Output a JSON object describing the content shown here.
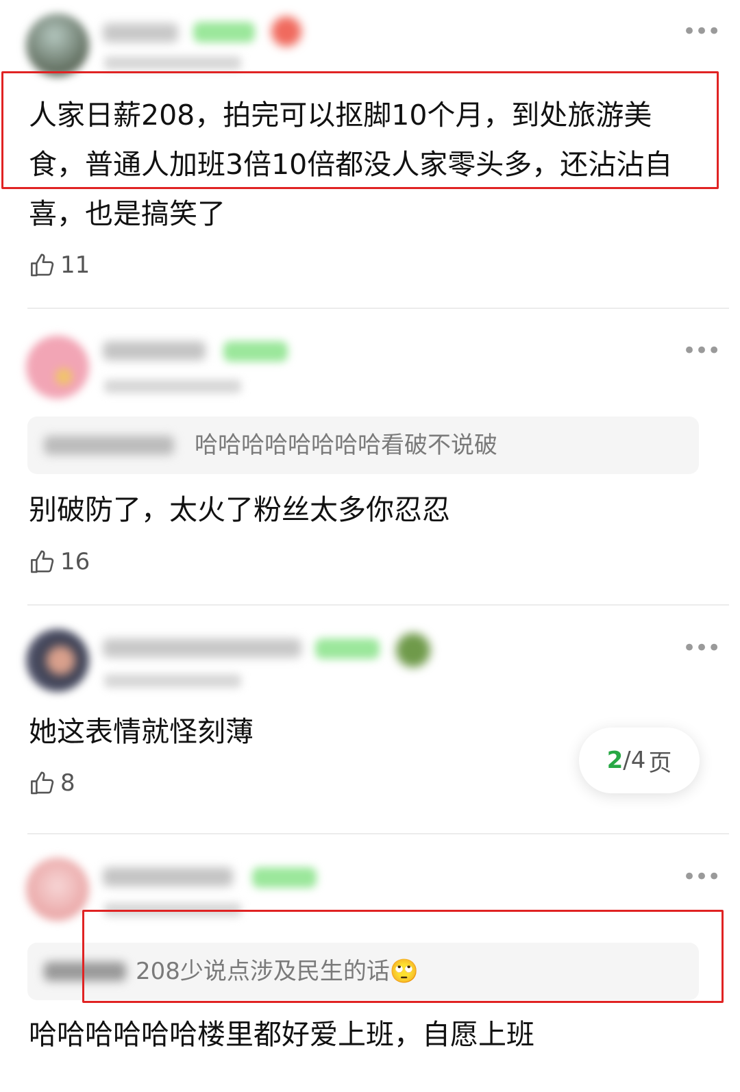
{
  "comments": [
    {
      "text": "人家日薪208，拍完可以抠脚10个月，到处旅游美食，普通人加班3倍10倍都没人家零头多，还沾沾自喜，也是搞笑了",
      "likes": "11"
    },
    {
      "quote_text": "哈哈哈哈哈哈哈哈看破不说破",
      "text": "别破防了，太火了粉丝太多你忍忍",
      "likes": "16"
    },
    {
      "text": "她这表情就怪刻薄",
      "likes": "8"
    },
    {
      "quote_text": "208少说点涉及民生的话🙄",
      "text": "哈哈哈哈哈哈楼里都好爱上班，自愿上班"
    }
  ],
  "pager": {
    "current": "2",
    "separator": "/",
    "total": "4",
    "unit": "页"
  },
  "icons": {
    "like": "thumb-up-icon",
    "more": "more-dots-icon"
  },
  "colors": {
    "highlight_box": "#e02323",
    "page_current": "#27a844"
  }
}
